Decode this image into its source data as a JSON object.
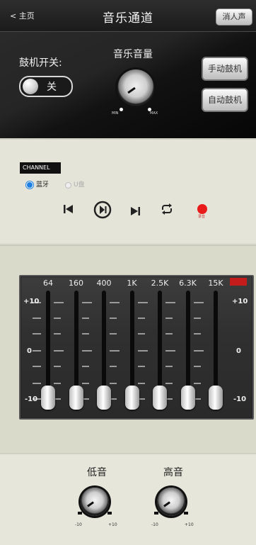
{
  "header": {
    "back_label": "< 主页",
    "title": "音乐通道",
    "noise_button": "消人声"
  },
  "drum": {
    "switch_label": "鼓机开关:",
    "toggle_state": "关",
    "manual_button": "手动鼓机",
    "auto_button": "自动鼓机"
  },
  "volume": {
    "label": "音乐音量",
    "min_label": "MIN",
    "max_label": "MAX"
  },
  "channel": {
    "tag": "CHANNEL",
    "sources": [
      {
        "label": "蓝牙",
        "selected": true
      },
      {
        "label": "U盘",
        "selected": false
      }
    ],
    "record_label": "录音"
  },
  "eq": {
    "bands": [
      "64",
      "160",
      "400",
      "1K",
      "2.5K",
      "6.3K",
      "15K"
    ],
    "band_levels_db": [
      -10,
      -10,
      -10,
      -10,
      -10,
      -10,
      -10
    ],
    "scale_top": "+10",
    "scale_mid": "0",
    "scale_bottom": "-10"
  },
  "tone": {
    "bass_label": "低音",
    "treble_label": "高音",
    "min_label": "-10",
    "max_label": "+10"
  },
  "colors": {
    "accent": "#1e7fe0",
    "record": "#e81a1a",
    "eq_marker": "#c41b1b"
  }
}
